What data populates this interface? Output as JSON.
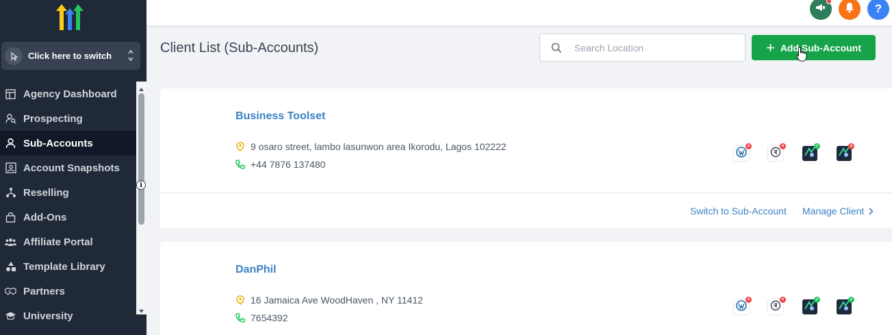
{
  "sidebar": {
    "switcher_label": "Click here to switch",
    "items": [
      {
        "label": "Agency Dashboard",
        "icon": "dashboard-icon"
      },
      {
        "label": "Prospecting",
        "icon": "user-search-icon"
      },
      {
        "label": "Sub-Accounts",
        "icon": "user-icon",
        "active": true
      },
      {
        "label": "Account Snapshots",
        "icon": "snapshot-icon"
      },
      {
        "label": "Reselling",
        "icon": "network-icon"
      },
      {
        "label": "Add-Ons",
        "icon": "bag-icon"
      },
      {
        "label": "Affiliate Portal",
        "icon": "users-icon"
      },
      {
        "label": "Template Library",
        "icon": "shapes-icon"
      },
      {
        "label": "Partners",
        "icon": "handshake-icon"
      },
      {
        "label": "University",
        "icon": "graduation-icon"
      }
    ],
    "info_glyph": "i"
  },
  "topbar": {
    "announce_color": "#2e7d5b",
    "notify_color": "#f97316",
    "help_color": "#3b82f6",
    "help_label": "?"
  },
  "header": {
    "title": "Client List (Sub-Accounts)",
    "search_placeholder": "Search Location",
    "add_button_label": "Add Sub-Account"
  },
  "clients": [
    {
      "name": "Business Toolset",
      "address": "9 osaro street, lambo lasunwon area Ikorodu, Lagos 102222",
      "phone": "+44 7876 137480",
      "switch_label": "Switch to Sub-Account",
      "manage_label": "Manage Client"
    },
    {
      "name": "DanPhil",
      "address": "16 Jamaica Ave WoodHaven , NY 11412",
      "phone": "7654392"
    }
  ],
  "integrations": [
    {
      "icon": "wordpress-icon",
      "status": "error"
    },
    {
      "icon": "payment-icon",
      "status": "error"
    },
    {
      "icon": "app-icon",
      "status": "ok"
    },
    {
      "icon": "app-icon",
      "status": "error"
    }
  ],
  "colors": {
    "accent_green": "#16a34a",
    "link_blue": "#3b82c4",
    "sidebar_bg": "#1f2937"
  }
}
